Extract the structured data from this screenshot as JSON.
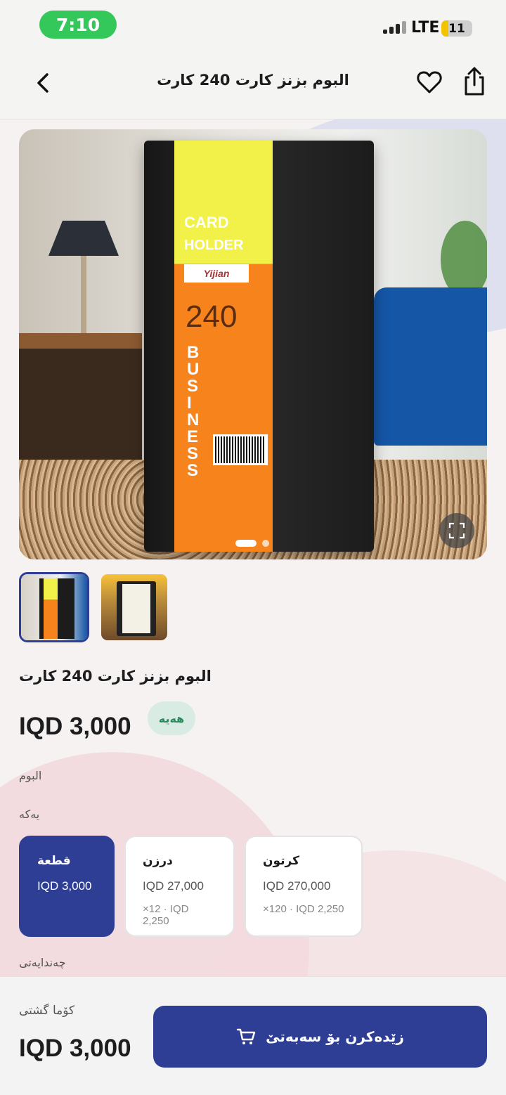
{
  "status": {
    "time": "7:10",
    "network": "LTE",
    "battery": "11"
  },
  "header": {
    "title": "البوم بزنز كارت 240 كارت"
  },
  "hero": {
    "card_text": "CARD",
    "holder_text": "HOLDER",
    "brand": "Yijian",
    "number": "240",
    "business_text": "BUSINESS",
    "slides": 2,
    "active_slide": 1
  },
  "product": {
    "title": "البوم بزنز كارت 240 كارت",
    "price": "IQD 3,000",
    "stock_badge": "هەیە",
    "category": "البوم",
    "unit_label": "یەکە",
    "quantity_label": "چەندایەتی"
  },
  "units": [
    {
      "name": "قطعة",
      "unit_price": "IQD 3,000",
      "per": ""
    },
    {
      "name": "درزن",
      "unit_price": "IQD 27,000",
      "per": "×12 · IQD 2,250"
    },
    {
      "name": "كرتون",
      "unit_price": "IQD 270,000",
      "per": "×120 · IQD 2,250"
    }
  ],
  "bottom": {
    "total_label": "کۆما گشتی",
    "total_price": "IQD 3,000",
    "add_to_cart": "زێدەکرن بۆ سەبەتێ"
  },
  "colors": {
    "primary": "#2e3e94",
    "stock_bg": "#d8ece4",
    "stock_text": "#2c8a5f",
    "time_pill": "#34c759"
  },
  "icons": [
    "back-chevron-icon",
    "heart-icon",
    "share-icon",
    "expand-icon",
    "cart-icon"
  ]
}
